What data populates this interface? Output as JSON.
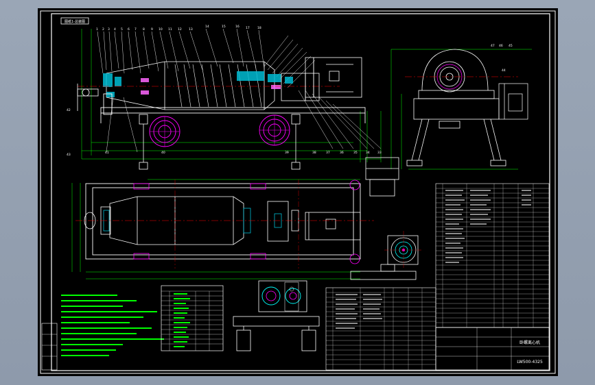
{
  "drawing": {
    "corner_tag": "图纸1-总装图",
    "title_block": {
      "title": "卧螺离心机",
      "drawing_number": "LW500-4325"
    }
  },
  "colors": {
    "paper": "#000000",
    "outline": "#ffffff",
    "center_line": "#ff0000",
    "dimension": "#00ff00",
    "section": "#00ffff",
    "wheel": "#ff00ff",
    "leader": "#ffff00",
    "background": "#97a3b3"
  }
}
